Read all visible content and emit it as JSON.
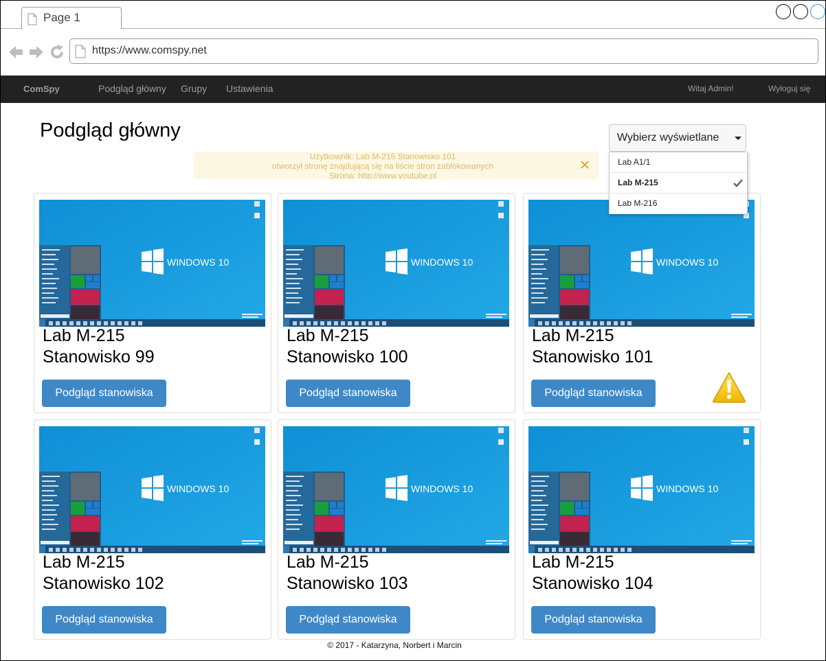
{
  "browser": {
    "tab_title": "Page 1",
    "url": "https://www.comspy.net",
    "icons": [
      "back-arrow-icon",
      "forward-arrow-icon",
      "reload-icon",
      "page-icon"
    ]
  },
  "navbar": {
    "brand": "ComSpy",
    "links": [
      "Podgląd główny",
      "Grupy",
      "Ustawienia"
    ],
    "greeting": "Witaj Admin!",
    "logout": "Wyloguj się"
  },
  "page": {
    "title": "Podgląd główny"
  },
  "select": {
    "label": "Wybierz wyświetlane",
    "options": [
      "Lab A1/1",
      "Lab M-215",
      "Lab M-216"
    ],
    "selected": "Lab M-215"
  },
  "alert": {
    "line1": "Użytkownik: Lab M-215 Stanowisko 101",
    "line2": "otworzył stronę znajdującą się na liście stron zablokowanych",
    "line3": "Strona: http://www.youtube.pl"
  },
  "screen_logo_text": "WINDOWS 10",
  "cards": [
    {
      "lab": "Lab M-215",
      "station": "Stanowisko 99",
      "button": "Podgląd stanowiska",
      "warning": false
    },
    {
      "lab": "Lab M-215",
      "station": "Stanowisko 100",
      "button": "Podgląd stanowiska",
      "warning": false
    },
    {
      "lab": "Lab M-215",
      "station": "Stanowisko 101",
      "button": "Podgląd stanowiska",
      "warning": true
    },
    {
      "lab": "Lab M-215",
      "station": "Stanowisko 102",
      "button": "Podgląd stanowiska",
      "warning": false
    },
    {
      "lab": "Lab M-215",
      "station": "Stanowisko 103",
      "button": "Podgląd stanowiska",
      "warning": false
    },
    {
      "lab": "Lab M-215",
      "station": "Stanowisko 104",
      "button": "Podgląd stanowiska",
      "warning": false
    }
  ],
  "footer": "© 2017 - Katarzyna, Norbert i Marcin",
  "colors": {
    "navbar_bg": "#222222",
    "button_bg": "#3f88c8",
    "alert_bg": "#fcf8e3",
    "alert_text": "#e0b96a",
    "desktop_bg": "#1ba1e2",
    "warning_yellow": "#f5c400"
  }
}
